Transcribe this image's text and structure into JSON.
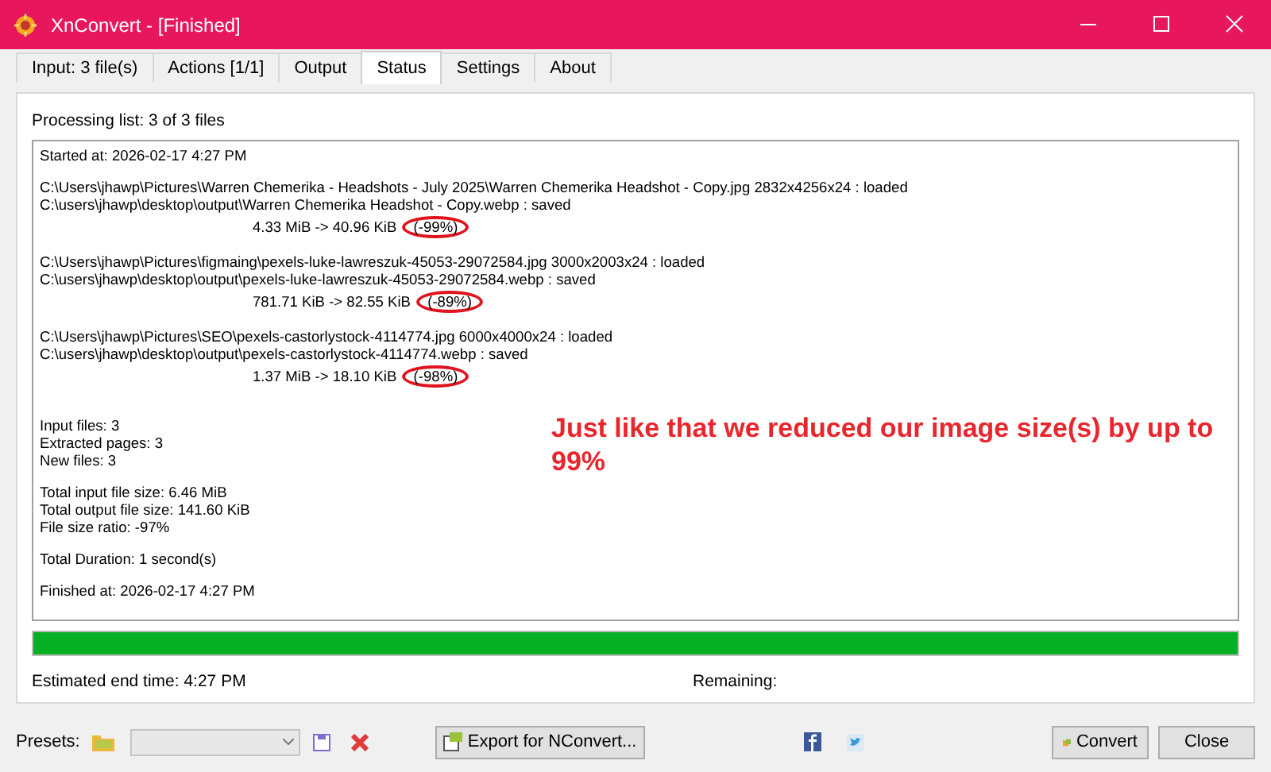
{
  "window": {
    "title": "XnConvert - [Finished]"
  },
  "tabs": [
    {
      "label": "Input: 3 file(s)",
      "selected": false
    },
    {
      "label": "Actions [1/1]",
      "selected": false
    },
    {
      "label": "Output",
      "selected": false
    },
    {
      "label": "Status",
      "selected": true
    },
    {
      "label": "Settings",
      "selected": false
    },
    {
      "label": "About",
      "selected": false
    }
  ],
  "processing_list": "Processing list:  3 of 3 files",
  "log": [
    {
      "kind": "line",
      "text": "Started at: 2026-02-17 4:27 PM"
    },
    {
      "kind": "gap"
    },
    {
      "kind": "line",
      "text": "C:\\Users\\jhawp\\Pictures\\Warren Chemerika - Headshots - July 2025\\Warren Chemerika Headshot - Copy.jpg 2832x4256x24 : loaded"
    },
    {
      "kind": "line",
      "text": "C:\\users\\jhawp\\desktop\\output\\Warren Chemerika Headshot - Copy.webp : saved"
    },
    {
      "kind": "result",
      "sizes": "4.33 MiB -> 40.96 KiB",
      "ratio": "(-99%)",
      "circled": true
    },
    {
      "kind": "gap"
    },
    {
      "kind": "line",
      "text": "C:\\Users\\jhawp\\Pictures\\figmaing\\pexels-luke-lawreszuk-45053-29072584.jpg 3000x2003x24 : loaded"
    },
    {
      "kind": "line",
      "text": "C:\\users\\jhawp\\desktop\\output\\pexels-luke-lawreszuk-45053-29072584.webp : saved"
    },
    {
      "kind": "result",
      "sizes": "781.71 KiB -> 82.55 KiB",
      "ratio": "(-89%)",
      "circled": true
    },
    {
      "kind": "gap"
    },
    {
      "kind": "line",
      "text": "C:\\Users\\jhawp\\Pictures\\SEO\\pexels-castorlystock-4114774.jpg 6000x4000x24 : loaded"
    },
    {
      "kind": "line",
      "text": "C:\\users\\jhawp\\desktop\\output\\pexels-castorlystock-4114774.webp : saved"
    },
    {
      "kind": "result",
      "sizes": "1.37 MiB -> 18.10 KiB",
      "ratio": "(-98%)",
      "circled": true
    },
    {
      "kind": "gap"
    },
    {
      "kind": "gap"
    },
    {
      "kind": "line",
      "text": "Input files: 3"
    },
    {
      "kind": "line",
      "text": "Extracted pages: 3"
    },
    {
      "kind": "line",
      "text": "New files: 3"
    },
    {
      "kind": "gap"
    },
    {
      "kind": "line",
      "text": "Total input file size: 6.46 MiB"
    },
    {
      "kind": "line",
      "text": "Total output file size: 141.60 KiB"
    },
    {
      "kind": "line",
      "text": "File size ratio: -97%"
    },
    {
      "kind": "gap"
    },
    {
      "kind": "line",
      "text": "Total Duration: 1 second(s)"
    },
    {
      "kind": "gap"
    },
    {
      "kind": "line",
      "text": "Finished at: 2026-02-17 4:27 PM"
    }
  ],
  "annotation": "Just like that we reduced our image size(s) by up to 99%",
  "progress": {
    "level": 1
  },
  "estimated_end_time": "Estimated end time:  4:27 PM",
  "remaining": "Remaining:",
  "footer": {
    "presets_label": "Presets:",
    "export_button": "Export for NConvert...",
    "convert_button": "Convert",
    "close_button": "Close"
  }
}
